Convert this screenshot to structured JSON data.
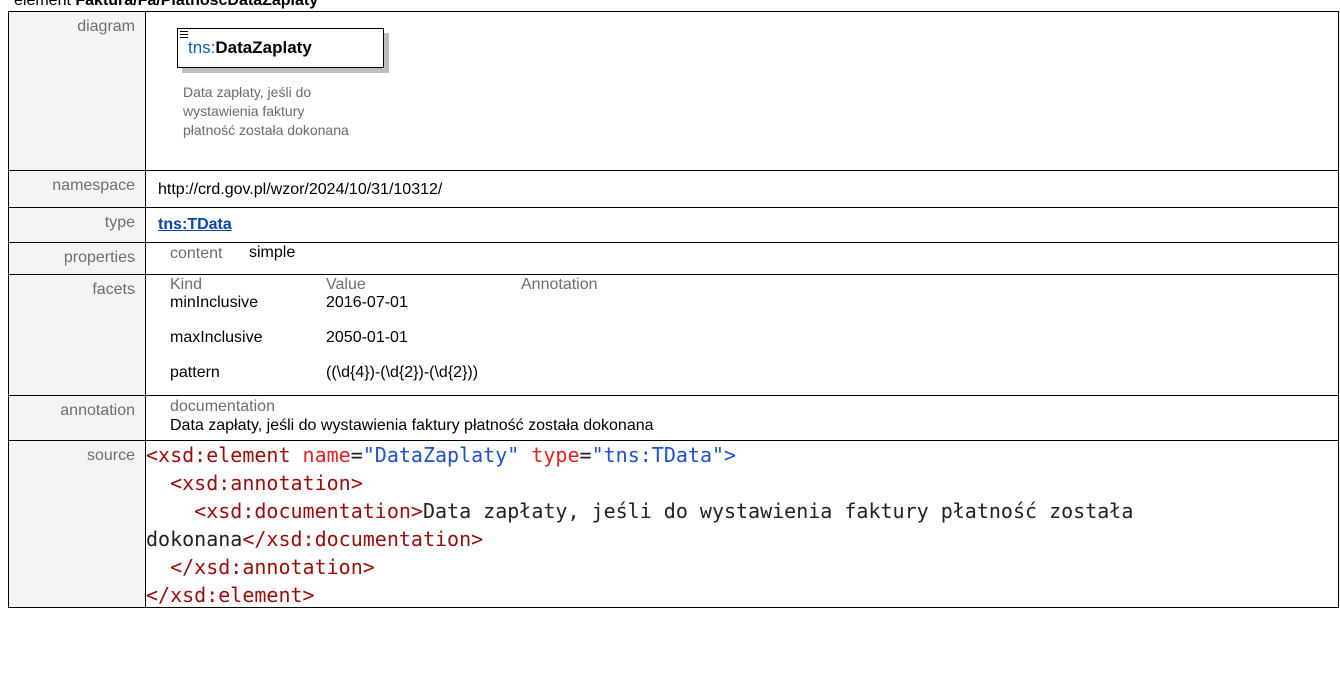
{
  "heading": {
    "prefix": "element ",
    "path": "Faktura/Fa/PlatnoscDataZaplaty"
  },
  "labels": {
    "diagram": "diagram",
    "namespace": "namespace",
    "type": "type",
    "properties": "properties",
    "facets": "facets",
    "annotation": "annotation",
    "source": "source"
  },
  "diagram": {
    "prefix": "tns:",
    "name": "DataZaplaty",
    "doc_lines": [
      "Data zapłaty, jeśli do",
      "wystawienia faktury",
      "płatność została dokonana"
    ]
  },
  "namespace": "http://crd.gov.pl/wzor/2024/10/31/10312/",
  "type": "tns:TData",
  "properties": {
    "key": "content",
    "value": "simple"
  },
  "facets": {
    "headers": [
      "Kind",
      "Value",
      "Annotation"
    ],
    "rows": [
      {
        "kind": "minInclusive",
        "value": "2016-07-01"
      },
      {
        "kind": "maxInclusive",
        "value": "2050-01-01"
      },
      {
        "kind": "pattern",
        "value": "((\\d{4})-(\\d{2})-(\\d{2}))"
      }
    ]
  },
  "annotation": {
    "key": "documentation",
    "value": "Data zapłaty, jeśli do wystawienia faktury płatność została dokonana"
  },
  "source": {
    "l1": {
      "open": "<xsd:element",
      "a1": " name",
      "eq1": "=",
      "v1": "\"DataZaplaty\"",
      "a2": " type",
      "eq2": "=",
      "v2": "\"tns:TData\"",
      "close": ">"
    },
    "l2": "  <xsd:annotation>",
    "l3": {
      "open": "    <xsd:documentation>",
      "text": "Data zapłaty, jeśli do wystawienia faktury płatność została"
    },
    "l4": {
      "text": "dokonana",
      "close": "</xsd:documentation>"
    },
    "l5": "  </xsd:annotation>",
    "l6": "</xsd:element>"
  }
}
